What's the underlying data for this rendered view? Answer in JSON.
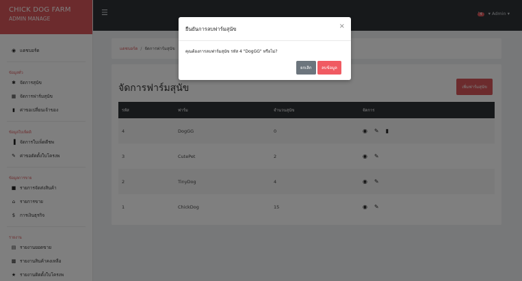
{
  "brand": {
    "title": "CHICK DOG FARM",
    "subtitle": "ADMIN MANAGE"
  },
  "sidebar": {
    "dashboard": {
      "label": "แดชบอร์ด",
      "icon": "dashboard-icon"
    },
    "section1": {
      "heading": "ข้อมูลทั่ว",
      "items": [
        {
          "label": "จัดการสุนัข",
          "icon": "paw-icon"
        },
        {
          "label": "จัดการฟาร์มสุนัข",
          "icon": "building-icon"
        },
        {
          "label": "ค่าขอเปลี่ยนเจ้าของ",
          "icon": "bookmark-icon"
        }
      ]
    },
    "section2": {
      "heading": "ข้อมูลใบเพ็ดดิ",
      "items": [
        {
          "label": "จัดการใบเพ็ดดีชพ",
          "icon": "file-icon"
        },
        {
          "label": "ค่าขอตัดตั้งใบโครงพ",
          "icon": "pencil-icon"
        }
      ]
    },
    "section3": {
      "heading": "ข้อมูลการขาย",
      "items": [
        {
          "label": "รายการจัดส่งสินค้า",
          "icon": "truck-icon"
        },
        {
          "label": "รายการขาย",
          "icon": "cart-icon"
        },
        {
          "label": "การเงินธุรกิจ",
          "icon": "dollar-icon"
        }
      ]
    },
    "section4": {
      "heading": "รายงาน",
      "items": [
        {
          "label": "รายงานยอดขาย",
          "icon": "report-icon"
        },
        {
          "label": "รายงานสินค้าคงเหลือ",
          "icon": "stock-icon"
        },
        {
          "label": "รายงานติดตั้งใบโครงพ",
          "icon": "star-icon"
        }
      ]
    }
  },
  "topbar": {
    "notification_count": "4",
    "user_label": "Admin",
    "caret": "▾"
  },
  "breadcrumb": {
    "home": "แดชบอร์ด",
    "separator": "/",
    "current": "จัดการฟาร์มสุนัข"
  },
  "page": {
    "title": "จัดการฟาร์มสุนัข",
    "add_button": "เพิ่มฟาร์มสุนัข"
  },
  "table": {
    "headers": [
      "รหัส",
      "ฟาร์ม",
      "จำนวนสุนัข",
      "จัดการ"
    ],
    "rows": [
      {
        "id": "4",
        "farm": "DogGG",
        "count": "0"
      },
      {
        "id": "3",
        "farm": "CutePet",
        "count": "2"
      },
      {
        "id": "2",
        "farm": "TinyDog",
        "count": "4"
      },
      {
        "id": "1",
        "farm": "ChickDog",
        "count": "15"
      }
    ]
  },
  "modal": {
    "title": "ยืนยันการลบฟาร์มสุนัข",
    "close": "×",
    "message": "คุณต้องการลบฟาร์มสุนัข รหัส 4 \"DogGG\" หรือไม่?",
    "cancel": "ยกเลิก",
    "confirm": "ลบข้อมูล"
  },
  "colors": {
    "accent": "#d8575a",
    "dark": "#2f3237",
    "danger": "#f05a62",
    "secondary": "#6c757d"
  }
}
